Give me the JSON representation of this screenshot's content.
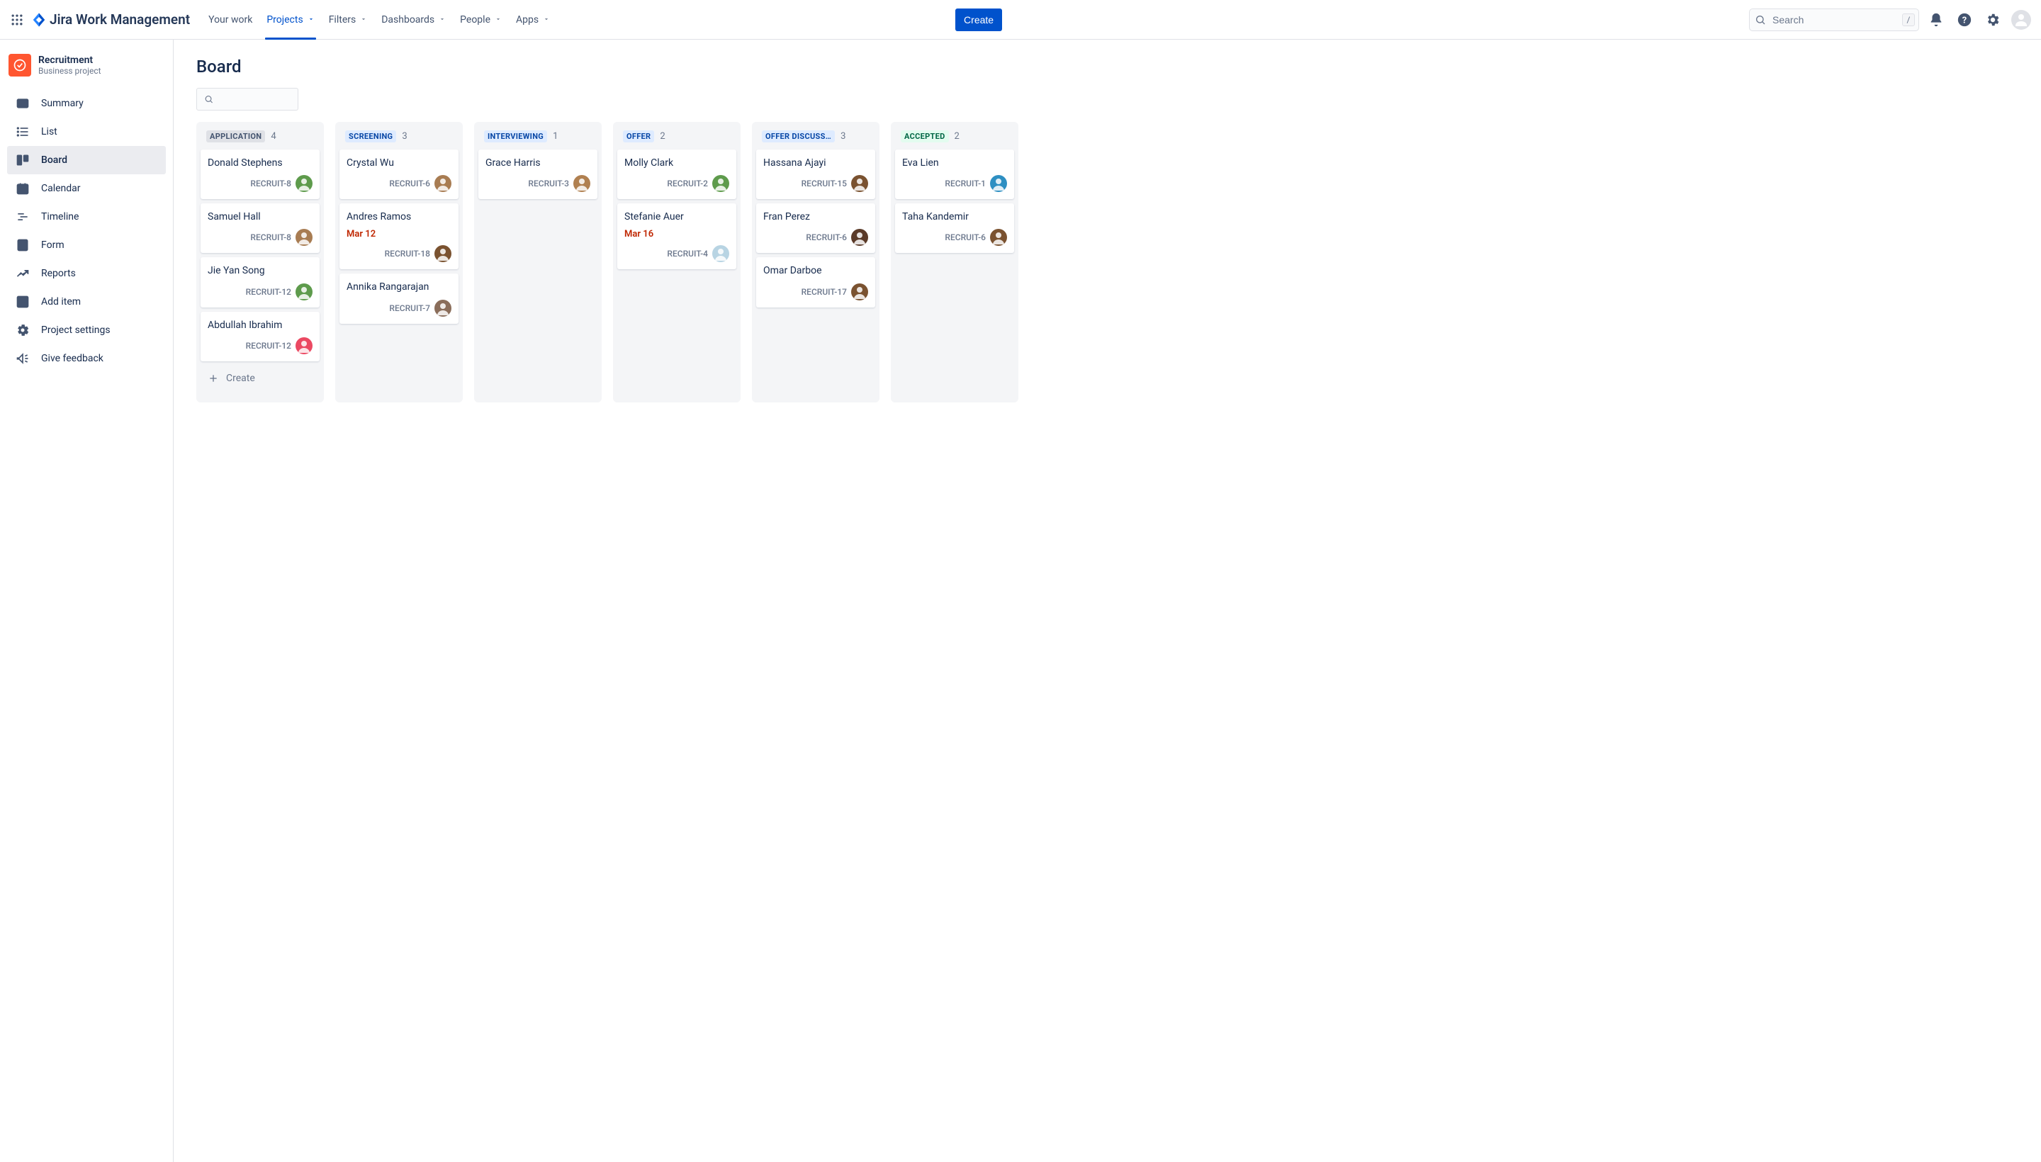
{
  "topbar": {
    "product_name": "Jira Work Management",
    "nav": [
      {
        "label": "Your work",
        "dropdown": false,
        "active": false
      },
      {
        "label": "Projects",
        "dropdown": true,
        "active": true
      },
      {
        "label": "Filters",
        "dropdown": true,
        "active": false
      },
      {
        "label": "Dashboards",
        "dropdown": true,
        "active": false
      },
      {
        "label": "People",
        "dropdown": true,
        "active": false
      },
      {
        "label": "Apps",
        "dropdown": true,
        "active": false
      }
    ],
    "create_label": "Create",
    "search_placeholder": "Search",
    "slash_hint": "/"
  },
  "sidebar": {
    "project_name": "Recruitment",
    "project_type": "Business project",
    "items": [
      {
        "key": "summary",
        "label": "Summary"
      },
      {
        "key": "list",
        "label": "List"
      },
      {
        "key": "board",
        "label": "Board",
        "active": true
      },
      {
        "key": "calendar",
        "label": "Calendar"
      },
      {
        "key": "timeline",
        "label": "Timeline"
      },
      {
        "key": "form",
        "label": "Form"
      },
      {
        "key": "reports",
        "label": "Reports"
      },
      {
        "key": "add",
        "label": "Add item"
      },
      {
        "key": "settings",
        "label": "Project settings"
      },
      {
        "key": "feedback",
        "label": "Give feedback"
      }
    ]
  },
  "main": {
    "title": "Board",
    "create_label": "Create"
  },
  "board": {
    "columns": [
      {
        "title": "APPLICATION",
        "color": "gray",
        "count": 4,
        "cards": [
          {
            "title": "Donald Stephens",
            "key": "RECRUIT-8",
            "avatar_bg": "#5e9b4c"
          },
          {
            "title": "Samuel Hall",
            "key": "RECRUIT-8",
            "avatar_bg": "#a87c52"
          },
          {
            "title": "Jie Yan Song",
            "key": "RECRUIT-12",
            "avatar_bg": "#5e9b4c"
          },
          {
            "title": "Abdullah Ibrahim",
            "key": "RECRUIT-12",
            "avatar_bg": "#eb4962"
          }
        ],
        "show_create": true
      },
      {
        "title": "SCREENING",
        "color": "blue",
        "count": 3,
        "cards": [
          {
            "title": "Crystal Wu",
            "key": "RECRUIT-6",
            "avatar_bg": "#a87c52"
          },
          {
            "title": "Andres Ramos",
            "date": "Mar 12",
            "key": "RECRUIT-18",
            "avatar_bg": "#7a5230"
          },
          {
            "title": "Annika Rangarajan",
            "key": "RECRUIT-7",
            "avatar_bg": "#8a6d5a"
          }
        ]
      },
      {
        "title": "INTERVIEWING",
        "color": "blue",
        "count": 1,
        "cards": [
          {
            "title": "Grace Harris",
            "key": "RECRUIT-3",
            "avatar_bg": "#b08050"
          }
        ]
      },
      {
        "title": "OFFER",
        "color": "blue",
        "count": 2,
        "cards": [
          {
            "title": "Molly Clark",
            "key": "RECRUIT-2",
            "avatar_bg": "#5e9b4c"
          },
          {
            "title": "Stefanie Auer",
            "date": "Mar 16",
            "key": "RECRUIT-4",
            "avatar_bg": "#b8d4e3"
          }
        ]
      },
      {
        "title": "OFFER DISCUSS…",
        "color": "blue",
        "count": 3,
        "cards": [
          {
            "title": "Hassana Ajayi",
            "key": "RECRUIT-15",
            "avatar_bg": "#7a5230"
          },
          {
            "title": "Fran Perez",
            "key": "RECRUIT-6",
            "avatar_bg": "#5a3a28"
          },
          {
            "title": "Omar Darboe",
            "key": "RECRUIT-17",
            "avatar_bg": "#7a5230"
          }
        ]
      },
      {
        "title": "ACCEPTED",
        "color": "green",
        "count": 2,
        "cards": [
          {
            "title": "Eva Lien",
            "key": "RECRUIT-1",
            "avatar_bg": "#2e8fc2"
          },
          {
            "title": "Taha Kandemir",
            "key": "RECRUIT-6",
            "avatar_bg": "#7a5230"
          }
        ]
      }
    ]
  }
}
